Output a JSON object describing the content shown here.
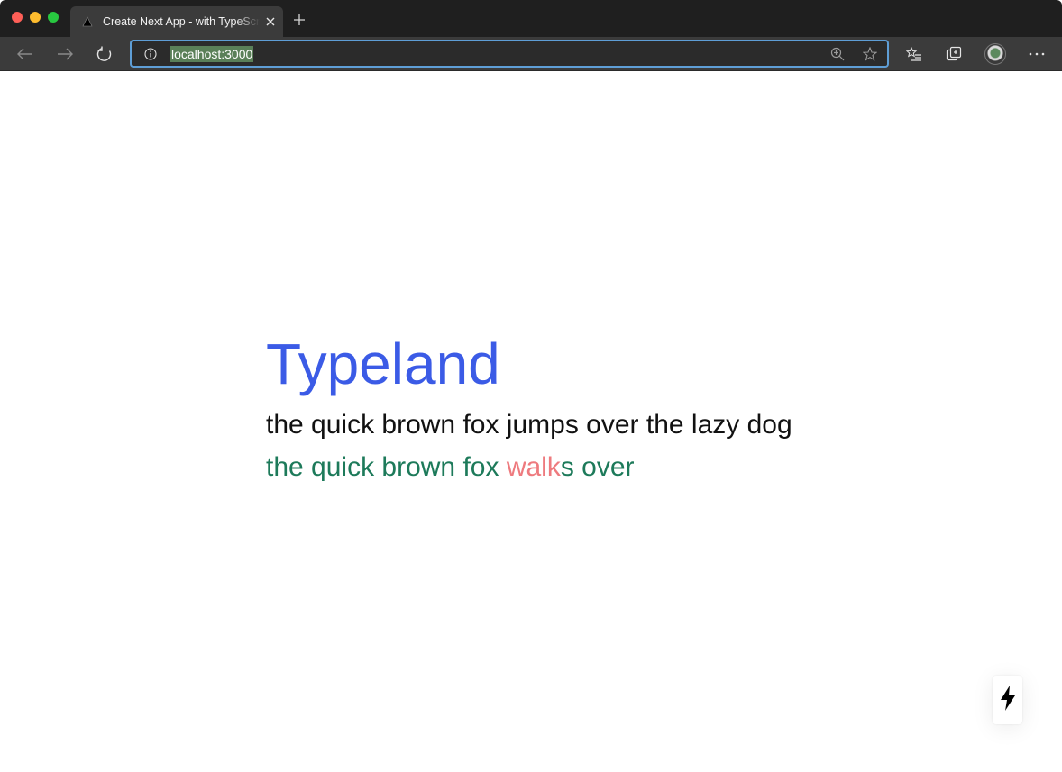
{
  "browser": {
    "tab_title": "Create Next App - with TypeScript",
    "url": "localhost:3000",
    "icons": {
      "favicon": "nextjs-triangle-icon",
      "close_tab": "close-icon",
      "new_tab": "plus-icon",
      "back": "arrow-left-icon",
      "forward": "arrow-right-icon",
      "refresh": "refresh-icon",
      "site_info": "info-icon",
      "zoom": "zoom-in-icon",
      "favorite": "star-icon",
      "favorites_list": "favorites-icon",
      "collections": "collections-icon",
      "profile": "avatar",
      "more": "ellipsis-icon"
    }
  },
  "page": {
    "title": "Typeland",
    "target_text": "the quick brown fox jumps over the lazy dog",
    "typed_correct_before": "the quick brown fox ",
    "typed_incorrect": "walk",
    "typed_correct_after": "s over",
    "colors": {
      "title": "#3b5be6",
      "correct": "#1d7a5a",
      "incorrect": "#ee7a7e"
    }
  },
  "dev_indicator": {
    "icon": "lightning-bolt-icon"
  }
}
